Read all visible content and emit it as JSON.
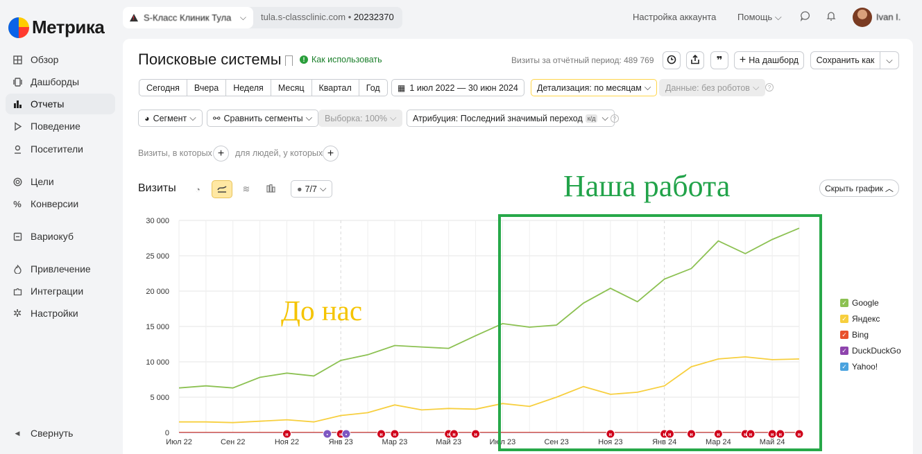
{
  "sidebar": {
    "logo": "Метрика",
    "items": [
      {
        "label": "Обзор",
        "icon": "grid-icon"
      },
      {
        "label": "Дашборды",
        "icon": "dashboard-icon"
      },
      {
        "label": "Отчеты",
        "icon": "reports-icon",
        "active": true
      },
      {
        "label": "Поведение",
        "icon": "play-icon"
      },
      {
        "label": "Посетители",
        "icon": "person-icon"
      },
      {
        "label": "Цели",
        "icon": "target-icon"
      },
      {
        "label": "Конверсии",
        "icon": "percent-icon"
      },
      {
        "label": "Вариокуб",
        "icon": "cube-icon"
      },
      {
        "label": "Привлечение",
        "icon": "fire-icon"
      },
      {
        "label": "Интеграции",
        "icon": "puzzle-icon"
      },
      {
        "label": "Настройки",
        "icon": "gear-icon"
      }
    ],
    "collapse": "Свернуть"
  },
  "topbar": {
    "counter_name": "S-Класс Клиник Тула",
    "counter_domain": "tula.s-classclinic.com",
    "counter_id": "20232370",
    "account_settings": "Настройка аккаунта",
    "help": "Помощь",
    "username": "Ivan I."
  },
  "report": {
    "title": "Поисковые системы",
    "how_to": "Как использовать",
    "visits_total": "Визиты за отчётный период: 489 769",
    "add_dashboard": "На дашборд",
    "save_as": "Сохранить как",
    "periods": [
      "Сегодня",
      "Вчера",
      "Неделя",
      "Месяц",
      "Квартал",
      "Год"
    ],
    "date_range": "1 июл 2022 — 30 июн 2024",
    "detail": "Детализация: по месяцам",
    "data_filter": "Данные: без роботов",
    "segment": "Сегмент",
    "compare": "Сравнить сегменты",
    "sample": "Выборка: 100%",
    "attribution": "Атрибуция: Последний значимый переход",
    "attribution_badge": "к/д",
    "filter_visits": "Визиты, в которых",
    "filter_people": "для людей, у которых",
    "chart_title": "Визиты",
    "series_count": "7/7",
    "hide_chart": "Скрыть график"
  },
  "annotations": {
    "our_work": "Наша работа",
    "before_us": "До нас"
  },
  "colors": {
    "google": "#8cc152",
    "yandex": "#f7cf3e",
    "bing": "#e8512c",
    "duckduckgo": "#8e44ad",
    "yahoo": "#4aa3df",
    "annotation_green": "#27a849",
    "annotation_yellow": "#f5c400"
  },
  "chart_data": {
    "type": "line",
    "x": [
      "Июл 22",
      "Авг 22",
      "Сен 22",
      "Окт 22",
      "Ноя 22",
      "Дек 22",
      "Янв 23",
      "Фев 23",
      "Мар 23",
      "Апр 23",
      "Май 23",
      "Июн 23",
      "Июл 23",
      "Авг 23",
      "Сен 23",
      "Окт 23",
      "Ноя 23",
      "Дек 23",
      "Янв 24",
      "Фев 24",
      "Мар 24",
      "Апр 24",
      "Май 24",
      "Июн 24"
    ],
    "x_tick_labels": [
      "Июл 22",
      "Сен 22",
      "Ноя 22",
      "Янв 23",
      "Мар 23",
      "Май 23",
      "Июл 23",
      "Сен 23",
      "Ноя 23",
      "Янв 24",
      "Мар 24",
      "Май 24"
    ],
    "y_ticks": [
      "0",
      "5 000",
      "10 000",
      "15 000",
      "20 000",
      "25 000",
      "30 000"
    ],
    "ylim": [
      0,
      30000
    ],
    "grid": true,
    "legend_position": "right",
    "series": [
      {
        "name": "Google",
        "color": "#8cc152",
        "values": [
          6300,
          6600,
          6300,
          7800,
          8400,
          8000,
          10200,
          11000,
          12300,
          12100,
          11900,
          13700,
          15400,
          14900,
          15200,
          18300,
          20400,
          18500,
          21700,
          23200,
          27100,
          25300,
          27300,
          28900
        ]
      },
      {
        "name": "Яндекс",
        "color": "#f7cf3e",
        "values": [
          1500,
          1500,
          1400,
          1600,
          1800,
          1500,
          2400,
          2800,
          3900,
          3200,
          3400,
          3300,
          4100,
          3700,
          5000,
          6500,
          5400,
          5700,
          6600,
          9300,
          10400,
          10700,
          10300,
          10400
        ]
      },
      {
        "name": "Bing",
        "color": "#e8512c",
        "values": [
          30,
          30,
          30,
          30,
          30,
          30,
          30,
          30,
          30,
          30,
          30,
          30,
          30,
          30,
          30,
          30,
          30,
          30,
          30,
          30,
          30,
          30,
          30,
          30
        ]
      },
      {
        "name": "DuckDuckGo",
        "color": "#8e44ad",
        "values": [
          5,
          5,
          5,
          5,
          5,
          5,
          5,
          5,
          5,
          5,
          5,
          5,
          5,
          5,
          5,
          5,
          5,
          5,
          5,
          5,
          5,
          5,
          5,
          5
        ]
      },
      {
        "name": "Yahoo!",
        "color": "#4aa3df",
        "values": [
          2,
          2,
          2,
          2,
          2,
          2,
          2,
          2,
          2,
          2,
          2,
          2,
          2,
          2,
          2,
          2,
          2,
          2,
          2,
          2,
          2,
          2,
          2,
          2
        ]
      }
    ]
  }
}
